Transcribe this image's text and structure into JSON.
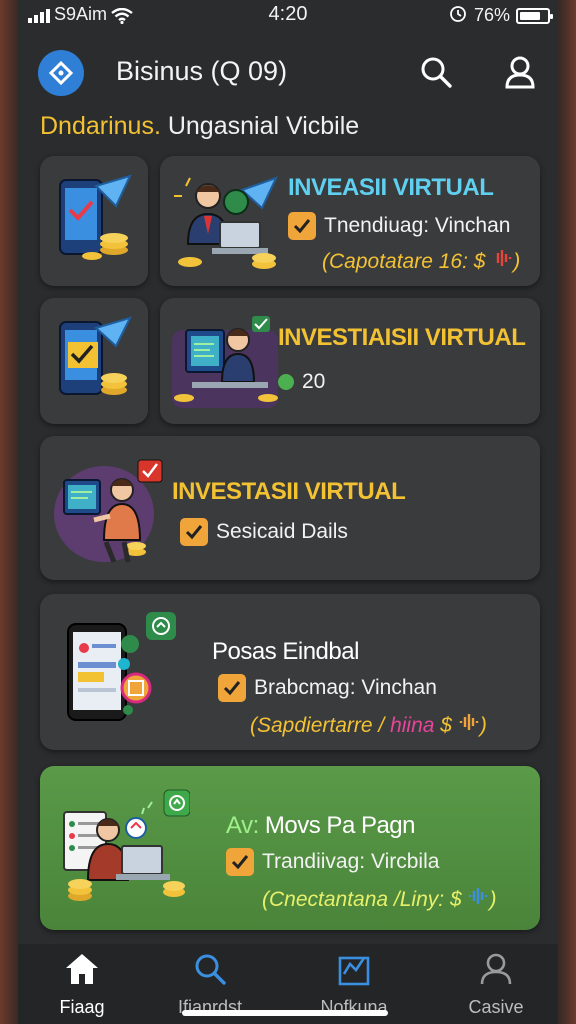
{
  "status": {
    "carrier": "S9Aim",
    "time": "4:20",
    "battery_pct": "76%",
    "battery_level": 0.76
  },
  "header": {
    "title": "Bisinus (Q 09)",
    "subtitle_highlight": "Dndarinus.",
    "subtitle_rest": " Ungasnial Vicbile"
  },
  "cards": [
    {
      "title": "INVEASII VIRTUAL",
      "line": "Tnendiuag: Vinchan",
      "sub": "(Capotatare 16: $"
    },
    {
      "title": "INVESTIAISII VIRTUAL",
      "value": "20"
    },
    {
      "title": "INVESTASII VIRTUAL",
      "line": "Sesicaid Dails"
    },
    {
      "title": "Posas Eindbal",
      "line": "Brabcmag: Vinchan",
      "sub_a": "(Sapdiertarre /",
      "sub_b": "hiina",
      "sub_c": "$"
    },
    {
      "title": "Av: Movs Pa Pagn",
      "line": "Trandiivag: Vircbila",
      "sub": "(Cnectantana /Liny: $"
    }
  ],
  "nav": [
    {
      "label": "Fiaag",
      "icon": "home-icon"
    },
    {
      "label": "Ifianrdst",
      "icon": "search-icon"
    },
    {
      "label": "Nofkuna",
      "icon": "chart-icon"
    },
    {
      "label": "Casive",
      "icon": "user-icon"
    }
  ],
  "colors": {
    "accent_yellow": "#f2c233",
    "accent_green": "#58d66a",
    "card_bg": "#3a3b3d",
    "green_card_bg": "#4f8f3e",
    "logo_blue": "#2f7fd6"
  }
}
